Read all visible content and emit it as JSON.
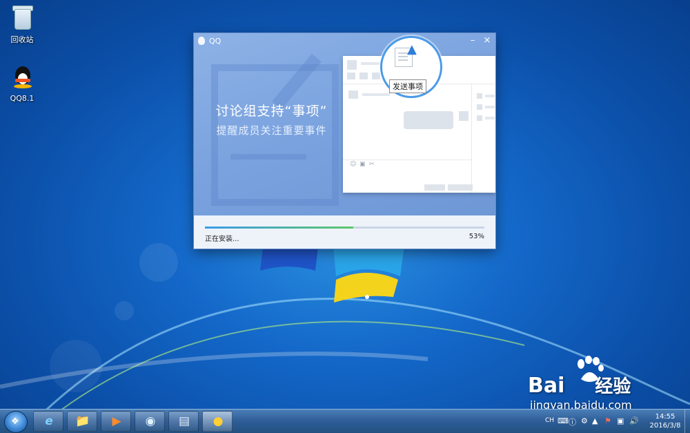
{
  "desktop": {
    "icons": [
      {
        "label": "回收站"
      },
      {
        "label": "QQ8.1"
      }
    ]
  },
  "installer": {
    "title": "QQ",
    "minimize_glyph": "–",
    "close_glyph": "×",
    "headline": "讨论组支持“事项”",
    "subline": "提醒成员关注重要事件",
    "tooltip": "发送事项",
    "status": "正在安装...",
    "progress_fraction": 0.53,
    "progress_label": "53%",
    "colors": {
      "progress_start": "#3a9be8",
      "progress_end": "#5cc76a",
      "header": "#7aa2de"
    }
  },
  "watermark": {
    "brand": "Bai",
    "brand_suffix": "经验",
    "site": "jingyan.baidu.com"
  },
  "taskbar": {
    "apps": [
      {
        "icon": "internet-explorer-icon"
      },
      {
        "icon": "file-explorer-icon"
      },
      {
        "icon": "media-player-icon"
      },
      {
        "icon": "video-app-icon"
      },
      {
        "icon": "notepad-icon"
      },
      {
        "icon": "qq-installer-icon"
      }
    ],
    "tray": {
      "language": "CH",
      "clock_time": "14:55",
      "clock_date": "2016/3/8"
    }
  }
}
